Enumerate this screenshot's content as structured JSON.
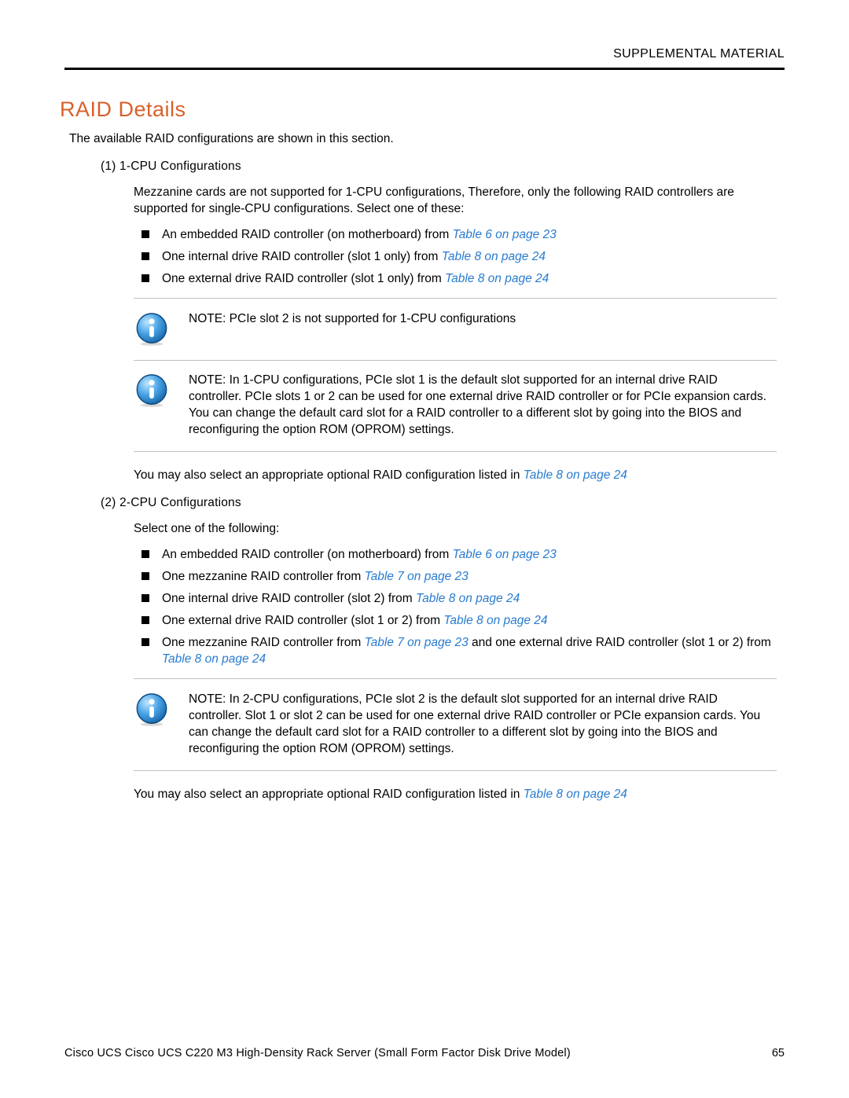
{
  "header": {
    "label": "SUPPLEMENTAL MATERIAL"
  },
  "section_title": "RAID Details",
  "intro": "The available RAID configurations are shown in this section.",
  "cpu1": {
    "heading": "(1) 1-CPU Configurations",
    "para": "Mezzanine cards are not supported for 1-CPU configurations, Therefore, only the following RAID controllers are supported for single-CPU configurations. Select one of these:",
    "bullets": [
      {
        "text": "An embedded RAID controller (on motherboard) from ",
        "link": "Table 6 on page 23"
      },
      {
        "text": "One internal drive RAID controller (slot 1 only) from ",
        "link": "Table 8 on page 24"
      },
      {
        "text": "One external drive RAID controller (slot 1 only) from ",
        "link": "Table 8 on page 24"
      }
    ],
    "note1": "NOTE:  PCIe slot 2 is not supported for 1-CPU configurations",
    "note2": "NOTE:  In 1-CPU configurations, PCIe slot 1 is the default slot supported for an internal drive RAID controller. PCIe slots 1 or 2 can be used for one external drive RAID controller or for PCIe expansion cards. You can change the default card slot for a RAID controller to a different slot by going into the BIOS and reconfiguring the option ROM (OPROM) settings.",
    "after": {
      "text": "You may also select an appropriate optional RAID configuration listed in ",
      "link": "Table 8 on page 24"
    }
  },
  "cpu2": {
    "heading": "(2) 2-CPU Configurations",
    "para": "Select one of the following:",
    "bullets": [
      {
        "text": "An embedded RAID controller (on motherboard) from ",
        "link": "Table 6 on page 23"
      },
      {
        "text": "One mezzanine RAID controller from ",
        "link": "Table 7 on page 23"
      },
      {
        "text": "One internal drive RAID controller (slot 2) from ",
        "link": "Table 8 on page 24"
      },
      {
        "text": "One external drive RAID controller (slot 1 or 2) from ",
        "link": "Table 8 on page 24"
      },
      {
        "pre": "One mezzanine RAID controller from ",
        "link1": "Table 7 on page 23",
        "mid": " and one external drive RAID controller (slot 1 or 2) from ",
        "link2": "Table 8 on page 24"
      }
    ],
    "note": "NOTE:  In 2-CPU configurations, PCIe slot 2 is the default slot supported for an internal drive RAID controller. Slot 1 or slot 2 can be used for one external drive RAID controller or PCIe expansion cards. You can change the default card slot for a RAID controller to a different slot by going into the BIOS and reconfiguring the option ROM (OPROM) settings.",
    "after": {
      "text": "You may also select an appropriate optional RAID configuration listed in ",
      "link": "Table 8 on page 24"
    }
  },
  "footer": {
    "title": "Cisco UCS Cisco UCS C220 M3 High-Density Rack Server (Small Form Factor Disk Drive Model)",
    "page": "65"
  }
}
